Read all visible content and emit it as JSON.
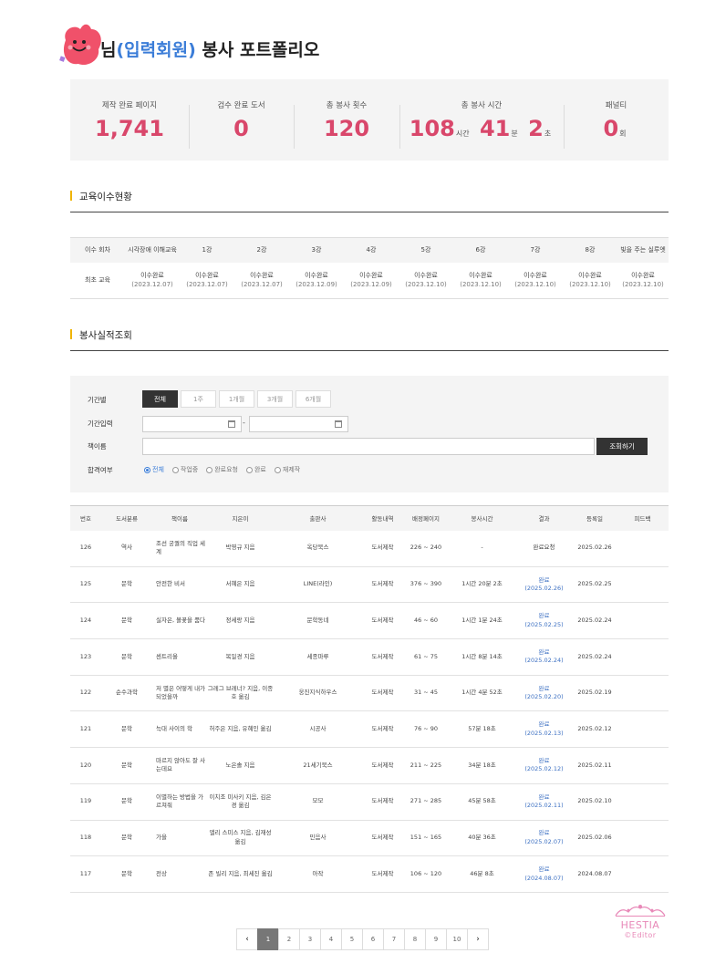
{
  "header": {
    "title_prefix": "님",
    "title_highlight": "(입력회원)",
    "title_suffix": " 봉사 포트폴리오"
  },
  "stats": {
    "pages": {
      "label": "제작 완료 페이지",
      "value": "1,741"
    },
    "books": {
      "label": "검수 완료 도서",
      "value": "0"
    },
    "count": {
      "label": "총 봉사 횟수",
      "value": "120"
    },
    "time": {
      "label": "총 봉사 시간",
      "hours": "108",
      "hours_unit": "시간",
      "minutes": "41",
      "minutes_unit": "분",
      "seconds": "2",
      "seconds_unit": "초"
    },
    "penalty": {
      "label": "패널티",
      "value": "0",
      "unit": "회"
    }
  },
  "education": {
    "section_title": "교육이수현황",
    "headers": [
      "이수 회차",
      "시각장애 이해교육",
      "1강",
      "2강",
      "3강",
      "4강",
      "5강",
      "6강",
      "7강",
      "8강",
      "빛을 주는 실루엣"
    ],
    "row_label": "최초 교육",
    "status": "이수완료",
    "dates": [
      "(2023.12.07)",
      "(2023.12.07)",
      "(2023.12.07)",
      "(2023.12.09)",
      "(2023.12.09)",
      "(2023.12.10)",
      "(2023.12.10)",
      "(2023.12.10)",
      "(2023.12.10)",
      "(2023.12.10)"
    ]
  },
  "search": {
    "section_title": "봉사실적조회",
    "period_label": "기간별",
    "period_tabs": [
      "전체",
      "1주",
      "1개월",
      "3개월",
      "6개월"
    ],
    "date_label": "기간입력",
    "date_sep": "-",
    "book_label": "책이름",
    "search_button": "조회하기",
    "pass_label": "합격여부",
    "pass_options": [
      "전체",
      "작업중",
      "완료요청",
      "완료",
      "재제작"
    ]
  },
  "results": {
    "headers": [
      "번호",
      "도서분류",
      "책이름",
      "지은이",
      "출판사",
      "활동내역",
      "배정페이지",
      "봉사시간",
      "결과",
      "등록일",
      "피드백"
    ],
    "rows": [
      {
        "no": "126",
        "cat": "역사",
        "title": "조선 궁궐의 직업 세계",
        "author": "박영규 지음",
        "pub": "옥당북스",
        "act": "도서제작",
        "pages": "226 ~ 240",
        "time": "-",
        "result": "완료요청",
        "rdate": "",
        "reg": "2025.02.26",
        "fb": ""
      },
      {
        "no": "125",
        "cat": "문학",
        "title": "안전한 비서",
        "author": "서혜은 지음",
        "pub": "LINE(라인)",
        "act": "도서제작",
        "pages": "376 ~ 390",
        "time": "1시간 20분 2초",
        "result": "완료",
        "rdate": "(2025.02.26)",
        "reg": "2025.02.25",
        "fb": ""
      },
      {
        "no": "124",
        "cat": "문학",
        "title": "실자은, 볼꽃을 품다",
        "author": "정세랑 지음",
        "pub": "문학동네",
        "act": "도서제작",
        "pages": "46 ~ 60",
        "time": "1시간 1분 24초",
        "result": "완료",
        "rdate": "(2025.02.25)",
        "reg": "2025.02.24",
        "fb": ""
      },
      {
        "no": "123",
        "cat": "문학",
        "title": "센트리올",
        "author": "복일경 지음",
        "pub": "세종마루",
        "act": "도서제작",
        "pages": "61 ~ 75",
        "time": "1시간 8분 14초",
        "result": "완료",
        "rdate": "(2025.02.24)",
        "reg": "2025.02.24",
        "fb": ""
      },
      {
        "no": "122",
        "cat": "순수과학",
        "title": "저 별은 어떻게 내가 되었을까",
        "author": "그레그 브레너? 지음, 이종호 옮김",
        "pub": "웅진지식하우스",
        "act": "도서제작",
        "pages": "31 ~ 45",
        "time": "1시간 4분 52초",
        "result": "완료",
        "rdate": "(2025.02.20)",
        "reg": "2025.02.19",
        "fb": ""
      },
      {
        "no": "121",
        "cat": "문학",
        "title": "늑대 사이의 학",
        "author": "허주은 지음, 유혜인 옮김",
        "pub": "시공사",
        "act": "도서제작",
        "pages": "76 ~ 90",
        "time": "57분 18초",
        "result": "완료",
        "rdate": "(2025.02.13)",
        "reg": "2025.02.12",
        "fb": ""
      },
      {
        "no": "120",
        "cat": "문학",
        "title": "마르지 않아도 잘 사는데요",
        "author": "노은솔 지음",
        "pub": "21세기북스",
        "act": "도서제작",
        "pages": "211 ~ 225",
        "time": "34분 18초",
        "result": "완료",
        "rdate": "(2025.02.12)",
        "reg": "2025.02.11",
        "fb": ""
      },
      {
        "no": "119",
        "cat": "문학",
        "title": "이별하는 방법을 가르쳐줘",
        "author": "이치조 미사키 지음, 김은경 옮김",
        "pub": "모모",
        "act": "도서제작",
        "pages": "271 ~ 285",
        "time": "45분 58초",
        "result": "완료",
        "rdate": "(2025.02.11)",
        "reg": "2025.02.10",
        "fb": ""
      },
      {
        "no": "118",
        "cat": "문학",
        "title": "가을",
        "author": "앨리 스미스 지음, 김재성 옮김",
        "pub": "민음사",
        "act": "도서제작",
        "pages": "151 ~ 165",
        "time": "40분 36초",
        "result": "완료",
        "rdate": "(2025.02.07)",
        "reg": "2025.02.06",
        "fb": ""
      },
      {
        "no": "117",
        "cat": "문학",
        "title": "전상",
        "author": "존 빌리 지음, 최세진 옮김",
        "pub": "아작",
        "act": "도서제작",
        "pages": "106 ~ 120",
        "time": "46분 8초",
        "result": "완료",
        "rdate": "(2024.08.07)",
        "reg": "2024.08.07",
        "fb": ""
      }
    ]
  },
  "pagination": {
    "prev": "‹",
    "pages": [
      "1",
      "2",
      "3",
      "4",
      "5",
      "6",
      "7",
      "8",
      "9",
      "10"
    ],
    "current": "1",
    "next": "›"
  },
  "logo": {
    "brand": "HESTIA",
    "sub": "©Editor",
    "color": "#e889b8"
  },
  "colors": {
    "accent": "#d9476b",
    "link": "#3b7dd8",
    "section_bar": "#f0b400"
  }
}
